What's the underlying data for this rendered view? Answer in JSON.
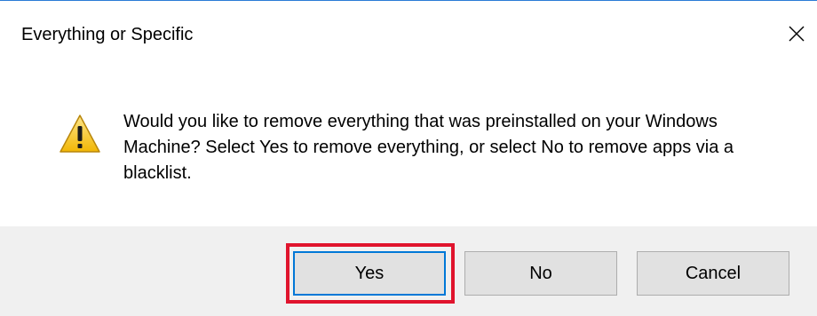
{
  "dialog": {
    "title": "Everything or Specific",
    "close_icon": "close-icon",
    "icon": "warning-icon",
    "message": "Would you like to remove everything that was preinstalled on your Windows Machine? Select Yes to remove everything, or select No to remove apps via a blacklist.",
    "buttons": {
      "yes_label": "Yes",
      "no_label": "No",
      "cancel_label": "Cancel"
    }
  },
  "colors": {
    "title_accent": "#2b7bd6",
    "footer_bg": "#f0f0f0",
    "button_bg": "#e1e1e1",
    "default_button_border": "#0078d7",
    "highlight": "#e0142d",
    "warning_fill": "#f5c518"
  }
}
